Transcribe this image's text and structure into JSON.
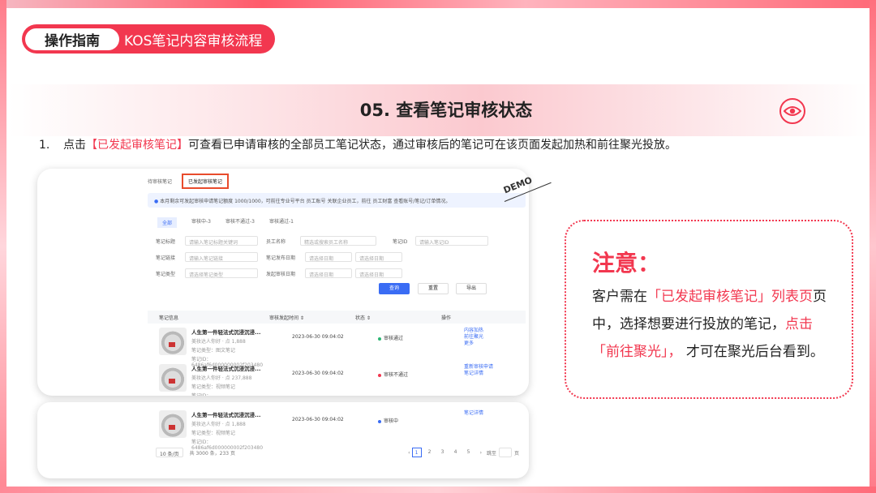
{
  "header": {
    "pill_left": "操作指南",
    "pill_right": "KOS笔记内容审核流程"
  },
  "section": {
    "title": "05. 查看笔记审核状态"
  },
  "step": {
    "num": "1.",
    "pre": "点击",
    "highlight": "【已发起审核笔记】",
    "post": "可查看已申请审核的全部员工笔记状态，通过审核后的笔记可在该页面发起加热和前往聚光投放。"
  },
  "screenshot": {
    "tabs": [
      "待审核笔记",
      "已发起审核笔记"
    ],
    "info": "本月剩余可发起审核申请笔记额度 1000/1000，可前往专业号平台 员工账号 关联企业员工，前往 员工财富 查看账号/笔记/订单情况。",
    "filter_tabs": [
      "全部",
      "审核中-3",
      "审核不通过-3",
      "审核通过-1"
    ],
    "filters": {
      "note_title": "笔记标题",
      "note_title_ph": "请输入笔记标题关键词",
      "staff_name": "员工名称",
      "staff_name_ph": "精选或搜索员工名称",
      "note_id": "笔记ID",
      "note_id_ph": "请输入笔记ID",
      "note_link": "笔记链接",
      "note_link_ph": "请输入笔记链接",
      "publish_date": "笔记发布日期",
      "audit_date": "发起审核日期",
      "start_ph": "请选择日期",
      "end_ph": "请选择日期",
      "note_type": "笔记类型",
      "note_type_ph": "请选择笔记类型"
    },
    "buttons": {
      "query": "查询",
      "reset": "重置",
      "export": "导出"
    },
    "columns": [
      "笔记信息",
      "审核发起时间 ⇕",
      "状态 ⇕",
      "操作"
    ],
    "rows": [
      {
        "title": "人生第一件轻法式沉浸沉浸...",
        "author": "美妆达人你好 · 点 1,888",
        "cat": "笔记类型：图文笔记",
        "id": "笔记ID：6486af6d000000002f203480",
        "time": "2023-06-30 09:04:02",
        "status": "审核通过",
        "ops": [
          "内容加热",
          "前往聚光",
          "更多"
        ],
        "color": "#2bb673"
      },
      {
        "title": "人生第一件轻法式沉浸沉浸...",
        "author": "美妆达人你好 · 点 237,888",
        "cat": "笔记类型：视频笔记",
        "id": "笔记ID：6486af6d000000002f203480",
        "time": "2023-06-30 09:04:02",
        "status": "审核不通过",
        "ops": [
          "重新审核申请",
          "笔记详情"
        ],
        "color": "#f2374f"
      },
      {
        "title": "人生第一件轻法式沉浸沉浸...",
        "author": "美妆达人你好 · 点 1,888",
        "cat": "笔记类型：视频笔记",
        "id": "笔记ID：6486af6d000000002f203480",
        "time": "2023-06-30 09:04:02",
        "status": "审核中",
        "ops": [
          "笔记详情"
        ],
        "color": "#3a6cf4"
      }
    ],
    "pager": {
      "size": "10 条/页",
      "total": "共 3000 条，233 页",
      "pages": [
        "1",
        "2",
        "3",
        "4",
        "5"
      ],
      "jump": "跳至",
      "page": "页"
    }
  },
  "demo": "DEMO",
  "note": {
    "title": "注意：",
    "p1": "客户需在",
    "h1": "「已发起审核笔记」列表页",
    "p2": "页中，选择想要进行投放的笔记，",
    "h2": "点击「前往聚光」，",
    "p3": "才可在聚光后台看到。"
  },
  "colors": {
    "accent": "#f2374f",
    "link": "#3a6cf4"
  }
}
